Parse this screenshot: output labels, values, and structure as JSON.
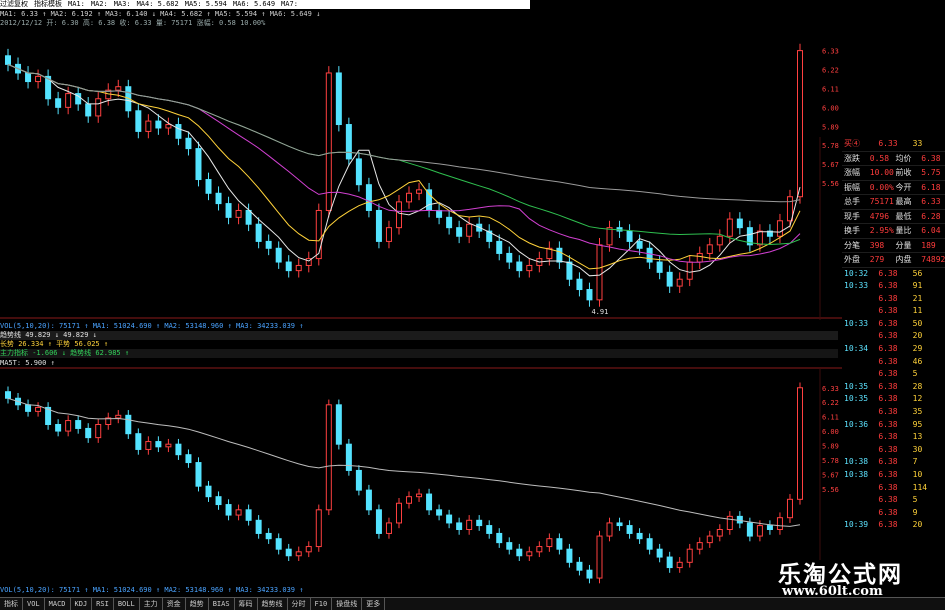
{
  "topbar": {
    "items": [
      "过滤复权",
      "指标模板",
      "MA1:",
      "MA2:",
      "MA3:",
      "MA4: 5.682",
      "MA5: 5.594",
      "MA6: 5.649",
      "MA7:"
    ]
  },
  "ma_line": "MA1: 6.33 ↑ MA2: 6.192 ↑ MA3: 6.140 ↓ MA4: 5.682 ↑ MA5: 5.594 ↑ MA6: 5.649 ↓",
  "info_line": "2012/12/12 开: 6.30 高: 6.38 收: 6.33 量: 75171 涨幅: 0.58 10.00%",
  "indicator_bars": [
    "VOL(5,10,20): 75171 ↑ MA1: 51024.690 ↑ MA2: 53148.960 ↑ MA3: 34233.039 ↑",
    "趋势线 49.829 ↓ 49.829 ↓",
    "长势 26.334 ↑ 平势 56.025 ↑",
    "主力指标 -1.606 ↓ 趋势线 62.985 ↑",
    "MA5T: 5.900 ↑"
  ],
  "bottom_vol": "VOL(5,10,20): 75171 ↑ MA1: 51024.690 ↑ MA2: 53148.960 ↑ MA3: 34233.039 ↑",
  "quote": {
    "code_label": "买④",
    "code_price": "6.33",
    "code_vol": "33",
    "rows": [
      {
        "l1": "涨跌",
        "v1": "0.58",
        "l2": "均价",
        "v2": "6.38"
      },
      {
        "l1": "涨幅",
        "v1": "10.00%",
        "l2": "前收",
        "v2": "5.75"
      },
      {
        "l1": "振幅",
        "v1": "0.00%",
        "l2": "今开",
        "v2": "6.18"
      },
      {
        "l1": "总手",
        "v1": "75171",
        "l2": "最高",
        "v2": "6.33"
      },
      {
        "l1": "现手",
        "v1": "4796",
        "l2": "最低",
        "v2": "6.28"
      },
      {
        "l1": "换手",
        "v1": "2.95%",
        "l2": "量比",
        "v2": "6.04"
      },
      {
        "l1": "分笔",
        "v1": "398",
        "l2": "分量",
        "v2": "189"
      },
      {
        "l1": "外盘",
        "v1": "279",
        "l2": "内盘",
        "v2": "74892"
      }
    ],
    "ticks": [
      {
        "t": "10:32",
        "p": "6.38",
        "v": "56"
      },
      {
        "t": "10:33",
        "p": "6.38",
        "v": "91"
      },
      {
        "t": "",
        "p": "6.38",
        "v": "21"
      },
      {
        "t": "",
        "p": "6.38",
        "v": "11"
      },
      {
        "t": "10:33",
        "p": "6.38",
        "v": "50"
      },
      {
        "t": "",
        "p": "6.38",
        "v": "20"
      },
      {
        "t": "10:34",
        "p": "6.38",
        "v": "29"
      },
      {
        "t": "",
        "p": "6.38",
        "v": "46"
      },
      {
        "t": "",
        "p": "6.38",
        "v": "5"
      },
      {
        "t": "10:35",
        "p": "6.38",
        "v": "28"
      },
      {
        "t": "10:35",
        "p": "6.38",
        "v": "12"
      },
      {
        "t": "",
        "p": "6.38",
        "v": "35"
      },
      {
        "t": "10:36",
        "p": "6.38",
        "v": "95"
      },
      {
        "t": "",
        "p": "6.38",
        "v": "13"
      },
      {
        "t": "",
        "p": "6.38",
        "v": "30"
      },
      {
        "t": "10:38",
        "p": "6.38",
        "v": "7"
      },
      {
        "t": "10:38",
        "p": "6.38",
        "v": "10"
      },
      {
        "t": "",
        "p": "6.38",
        "v": "114"
      },
      {
        "t": "",
        "p": "6.38",
        "v": "5"
      },
      {
        "t": "",
        "p": "6.38",
        "v": "9"
      },
      {
        "t": "10:39",
        "p": "6.38",
        "v": "20"
      }
    ]
  },
  "price_axis": [
    "6.33",
    "6.22",
    "6.11",
    "6.00",
    "5.89",
    "5.78",
    "5.67",
    "5.56"
  ],
  "low_label": "4.91",
  "toolbar": [
    "指标",
    "VOL",
    "MACD",
    "KDJ",
    "RSI",
    "BOLL",
    "主力",
    "资金",
    "趋势",
    "BIAS",
    "筹码",
    "趋势线",
    "分时",
    "F10",
    "操盘线",
    "更多"
  ],
  "watermark": {
    "title": "乐淘公式网",
    "url": "www.60lt.com"
  },
  "chart_data": {
    "type": "candlestick",
    "closes": [
      6.25,
      6.2,
      6.15,
      6.18,
      6.05,
      6.0,
      6.08,
      6.02,
      5.95,
      6.05,
      6.1,
      6.12,
      5.98,
      5.86,
      5.92,
      5.88,
      5.9,
      5.82,
      5.76,
      5.58,
      5.5,
      5.44,
      5.36,
      5.4,
      5.32,
      5.22,
      5.18,
      5.1,
      5.05,
      5.08,
      5.12,
      5.4,
      6.2,
      5.9,
      5.7,
      5.55,
      5.4,
      5.22,
      5.3,
      5.45,
      5.5,
      5.52,
      5.4,
      5.36,
      5.3,
      5.25,
      5.32,
      5.28,
      5.22,
      5.15,
      5.1,
      5.05,
      5.08,
      5.12,
      5.18,
      5.1,
      5.0,
      4.94,
      4.88,
      5.2,
      5.3,
      5.28,
      5.22,
      5.18,
      5.1,
      5.04,
      4.96,
      5.0,
      5.1,
      5.15,
      5.2,
      5.25,
      5.35,
      5.3,
      5.2,
      5.28,
      5.25,
      5.34,
      5.48,
      6.33
    ]
  }
}
